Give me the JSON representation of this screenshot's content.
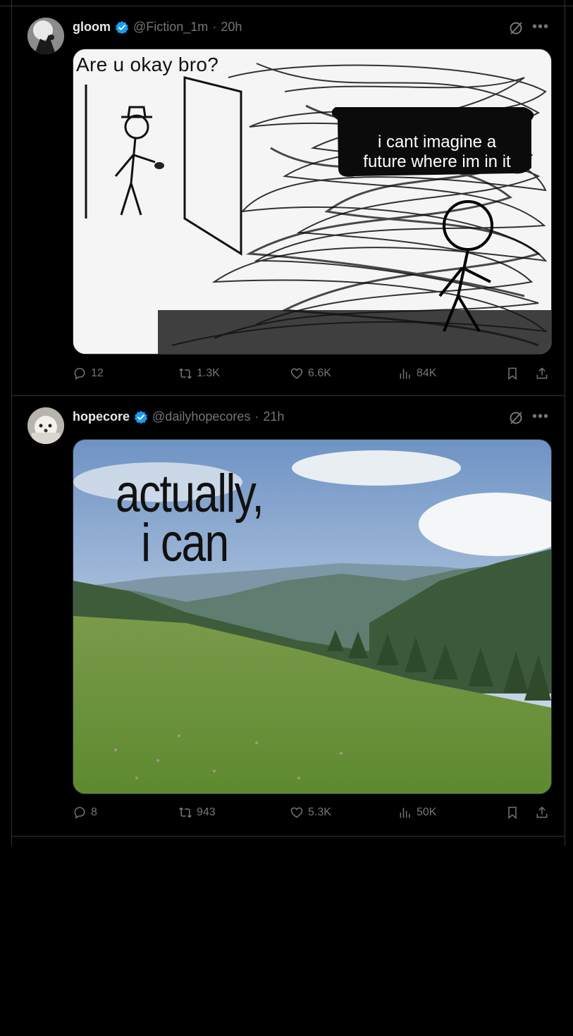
{
  "posts": [
    {
      "name": "gloom",
      "handle": "@Fiction_1m",
      "separator": "·",
      "time": "20h",
      "media": {
        "kind": "meme",
        "top_text": "Are u okay bro?",
        "bubble_line1": "i cant imagine a",
        "bubble_line2": "future where im in it"
      },
      "actions": {
        "replies": "12",
        "reposts": "1.3K",
        "likes": "6.6K",
        "views": "84K"
      }
    },
    {
      "name": "hopecore",
      "handle": "@dailyhopecores",
      "separator": "·",
      "time": "21h",
      "media": {
        "kind": "landscape",
        "line1": "actually,",
        "line2": "i can"
      },
      "actions": {
        "replies": "8",
        "reposts": "943",
        "likes": "5.3K",
        "views": "50K"
      }
    }
  ],
  "icons": {
    "verified": "verified-badge-icon",
    "grok": "grok-icon",
    "more": "more-icon",
    "reply": "reply-icon",
    "repost": "repost-icon",
    "like": "like-icon",
    "views": "views-icon",
    "bookmark": "bookmark-icon",
    "share": "share-icon"
  },
  "colors": {
    "background": "#000000",
    "text": "#e7e9ea",
    "muted": "#71767b",
    "border": "#2f3336",
    "verified": "#1d9bf0"
  }
}
